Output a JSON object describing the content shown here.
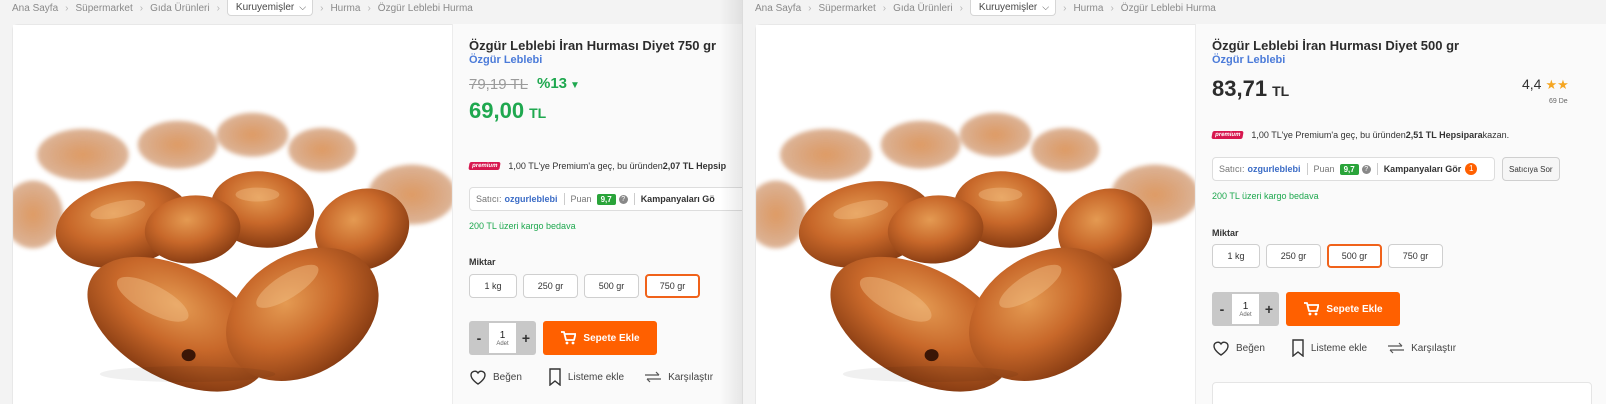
{
  "breadcrumb": {
    "items": [
      "Ana Sayfa",
      "Süpermarket",
      "Gıda Ürünleri"
    ],
    "dropdown": "Kuruyemişler",
    "tail": [
      "Hurma",
      "Özgür Leblebi Hurma"
    ]
  },
  "colors": {
    "accent": "#ff6000",
    "discount": "#1fa84f",
    "brand_link": "#4b7bd9",
    "premium": "#d7184f"
  },
  "left": {
    "title": "Özgür Leblebi İran Hurması Diyet 750 gr",
    "brand": "Özgür Leblebi",
    "old_price": "79,19 TL",
    "discount": "%13",
    "price": "69,00",
    "currency": "TL",
    "premium_badge": "premium",
    "premium_text_a": "1,00 TL'ye Premium'a geç, bu üründen ",
    "premium_amount": "2,07 TL Hepsip",
    "seller_label": "Satıcı:",
    "seller_name": "ozgurleblebi",
    "score_label": "Puan",
    "score": "9,7",
    "campaigns": "Kampanyaları Gö",
    "cargo": "200 TL üzeri kargo bedava",
    "miktar": "Miktar",
    "options": [
      "1 kg",
      "250 gr",
      "500 gr",
      "750 gr"
    ],
    "selected_index": 3,
    "qty_minus": "-",
    "qty_value": "1",
    "qty_unit": "Adet",
    "qty_plus": "+",
    "cart": "Sepete Ekle",
    "like": "Beğen",
    "list": "Listeme ekle",
    "compare": "Karşılaştır"
  },
  "right": {
    "title": "Özgür Leblebi İran Hurması Diyet 500 gr",
    "brand": "Özgür Leblebi",
    "price": "83,71",
    "currency": "TL",
    "rating": "4,4",
    "rating_value": 4.4,
    "stars": "★★",
    "rating_count": "69 De",
    "premium_badge": "premium",
    "premium_text_a": "1,00 TL'ye Premium'a geç, bu üründen ",
    "premium_amount": "2,51 TL Hepsipara",
    "premium_text_b": " kazan.",
    "seller_label": "Satıcı:",
    "seller_name": "ozgurleblebi",
    "score_label": "Puan",
    "score": "9,7",
    "campaigns": "Kampanyaları Gör",
    "campaign_count": "1",
    "ask_seller": "Satıcıya Sor",
    "cargo": "200 TL üzeri kargo bedava",
    "miktar": "Miktar",
    "options": [
      "1 kg",
      "250 gr",
      "500 gr",
      "750 gr"
    ],
    "selected_index": 2,
    "qty_minus": "-",
    "qty_value": "1",
    "qty_unit": "Adet",
    "qty_plus": "+",
    "cart": "Sepete Ekle",
    "like": "Beğen",
    "list": "Listeme ekle",
    "compare": "Karşılaştır"
  },
  "icons": [
    "chevron-down-icon",
    "cart-icon",
    "heart-icon",
    "bookmark-icon",
    "compare-arrows-icon",
    "help-icon",
    "star-icon"
  ]
}
